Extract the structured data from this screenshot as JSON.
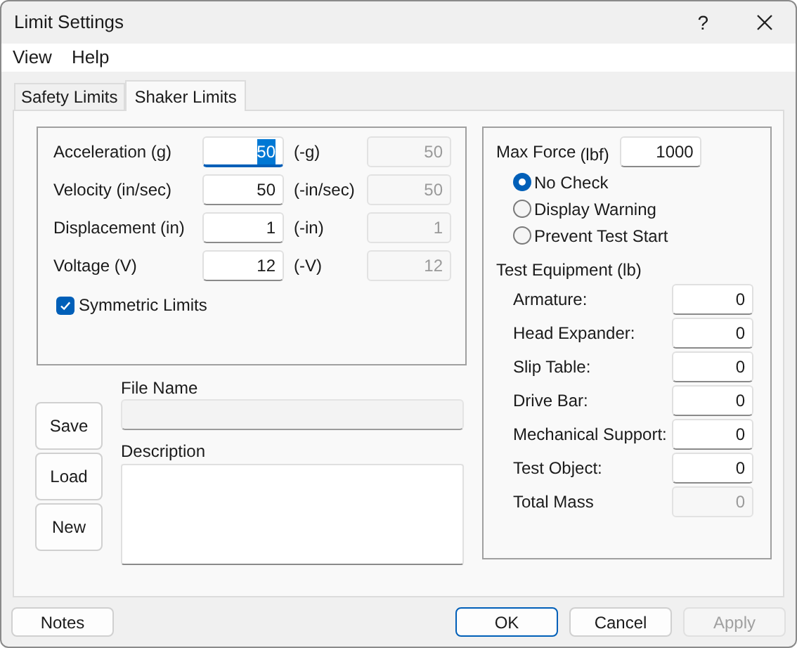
{
  "window": {
    "title": "Limit Settings",
    "help": "?"
  },
  "menu": [
    {
      "label": "View"
    },
    {
      "label": "Help"
    }
  ],
  "tabs": [
    {
      "label": "Safety Limits",
      "selected": false
    },
    {
      "label": "Shaker Limits",
      "selected": true
    }
  ],
  "limits": [
    {
      "label": "Acceleration (g)",
      "value": "50",
      "focused": true,
      "neg_label": "(-g)",
      "neg_value": "50",
      "neg_disabled": true
    },
    {
      "label": "Velocity (in/sec)",
      "value": "50",
      "focused": false,
      "neg_label": "(-in/sec)",
      "neg_value": "50",
      "neg_disabled": true
    },
    {
      "label": "Displacement (in)",
      "value": "1",
      "focused": false,
      "neg_label": "(-in)",
      "neg_value": "1",
      "neg_disabled": true
    },
    {
      "label": "Voltage (V)",
      "value": "12",
      "focused": false,
      "neg_label": "(-V)",
      "neg_value": "12",
      "neg_disabled": true
    }
  ],
  "symmetric": {
    "label": "Symmetric Limits",
    "checked": true
  },
  "file_buttons": [
    {
      "label": "Save"
    },
    {
      "label": "Load"
    },
    {
      "label": "New"
    }
  ],
  "file_name": {
    "label": "File Name",
    "disabled": true
  },
  "description": {
    "label": "Description"
  },
  "max_force": {
    "label": "Max Force",
    "unit": "(lbf)",
    "value": "1000"
  },
  "force_options": [
    {
      "label": "No Check",
      "selected": true
    },
    {
      "label": "Display Warning",
      "selected": false
    },
    {
      "label": "Prevent Test Start",
      "selected": false
    }
  ],
  "equipment": {
    "title": "Test Equipment (lb)",
    "rows": [
      {
        "label": "Armature:",
        "value": "0",
        "disabled": false
      },
      {
        "label": "Head Expander:",
        "value": "0",
        "disabled": false
      },
      {
        "label": "Slip Table:",
        "value": "0",
        "disabled": false
      },
      {
        "label": "Drive Bar:",
        "value": "0",
        "disabled": false
      },
      {
        "label": "Mechanical Support:",
        "value": "0",
        "disabled": false
      },
      {
        "label": "Test Object:",
        "value": "0",
        "disabled": false
      },
      {
        "label": "Total Mass",
        "value": "0",
        "disabled": true
      }
    ]
  },
  "notes_button": {
    "label": "Notes"
  },
  "buttons": [
    {
      "label": "OK",
      "default": true,
      "disabled": false
    },
    {
      "label": "Cancel",
      "default": false,
      "disabled": false
    },
    {
      "label": "Apply",
      "default": false,
      "disabled": true
    }
  ]
}
